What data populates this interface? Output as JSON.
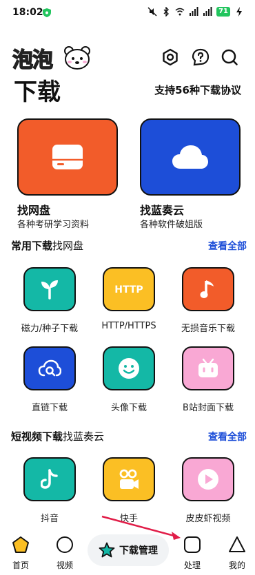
{
  "status_bar": {
    "time": "18:02",
    "battery": "71"
  },
  "header": {
    "logo_text": "泡泡",
    "title": "下载",
    "subtitle": "支持56种下载协议"
  },
  "hero_cards": [
    {
      "title": "找网盘",
      "desc": "各种考研学习资料",
      "color": "#f25c2a",
      "icon": "hard-drive-icon"
    },
    {
      "title": "找蓝奏云",
      "desc": "各种软件破姐版",
      "color": "#1d4ed8",
      "icon": "cloud-icon"
    }
  ],
  "section_common": {
    "bold": "常用下载",
    "rest": "找网盘",
    "link": "查看全部"
  },
  "common_items": [
    {
      "label": "磁力/种子下载",
      "color": "#14b8a6",
      "icon": "sprout-icon"
    },
    {
      "label": "HTTP/HTTPS",
      "color": "#fbbf24",
      "icon": "http-icon",
      "icon_text": "HTTP"
    },
    {
      "label": "无损音乐下载",
      "color": "#f25c2a",
      "icon": "music-note-icon"
    },
    {
      "label": "直链下载",
      "color": "#1d4ed8",
      "icon": "cloud-search-icon"
    },
    {
      "label": "头像下载",
      "color": "#14b8a6",
      "icon": "smiley-icon"
    },
    {
      "label": "B站封面下载",
      "color": "#f9a8d4",
      "icon": "bilibili-icon"
    }
  ],
  "section_video": {
    "bold": "短视频下载",
    "rest": "找蓝奏云",
    "link": "查看全部"
  },
  "video_items": [
    {
      "label": "抖音",
      "color": "#14b8a6",
      "icon": "tiktok-icon"
    },
    {
      "label": "快手",
      "color": "#fbbf24",
      "icon": "kuaishou-icon"
    },
    {
      "label": "皮皮虾视频",
      "color": "#f9a8d4",
      "icon": "play-icon"
    }
  ],
  "nav": {
    "home": "首页",
    "video": "视频",
    "download_manager": "下载管理",
    "process": "处理",
    "mine": "我的"
  }
}
